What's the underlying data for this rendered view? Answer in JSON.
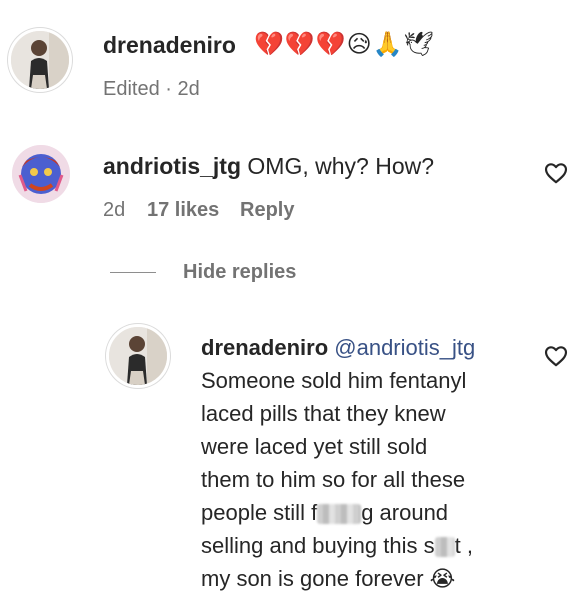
{
  "comment1": {
    "username": "drenadeniro",
    "emojis": "💔💔💔😥🙏🕊",
    "meta": "Edited · 2d"
  },
  "comment2": {
    "username": "andriotis_jtg",
    "text": "OMG, why? How?",
    "time": "2d",
    "likes": "17 likes",
    "reply_label": "Reply",
    "hide_replies": "Hide replies"
  },
  "reply": {
    "username": "drenadeniro",
    "mention": "@andriotis_jtg",
    "lines": [
      "Someone sold him fentanyl",
      "laced pills that they knew",
      "were laced yet still sold",
      "them to him so for all these"
    ],
    "line5_a": "people still f",
    "line5_b": "g around",
    "line6_a": "selling and buying this s",
    "line6_b": "t ,",
    "line7": "my son is gone forever",
    "line7_emoji": "😭"
  },
  "colors": {
    "text": "#262626",
    "secondary": "#737373",
    "mention": "#385185"
  }
}
